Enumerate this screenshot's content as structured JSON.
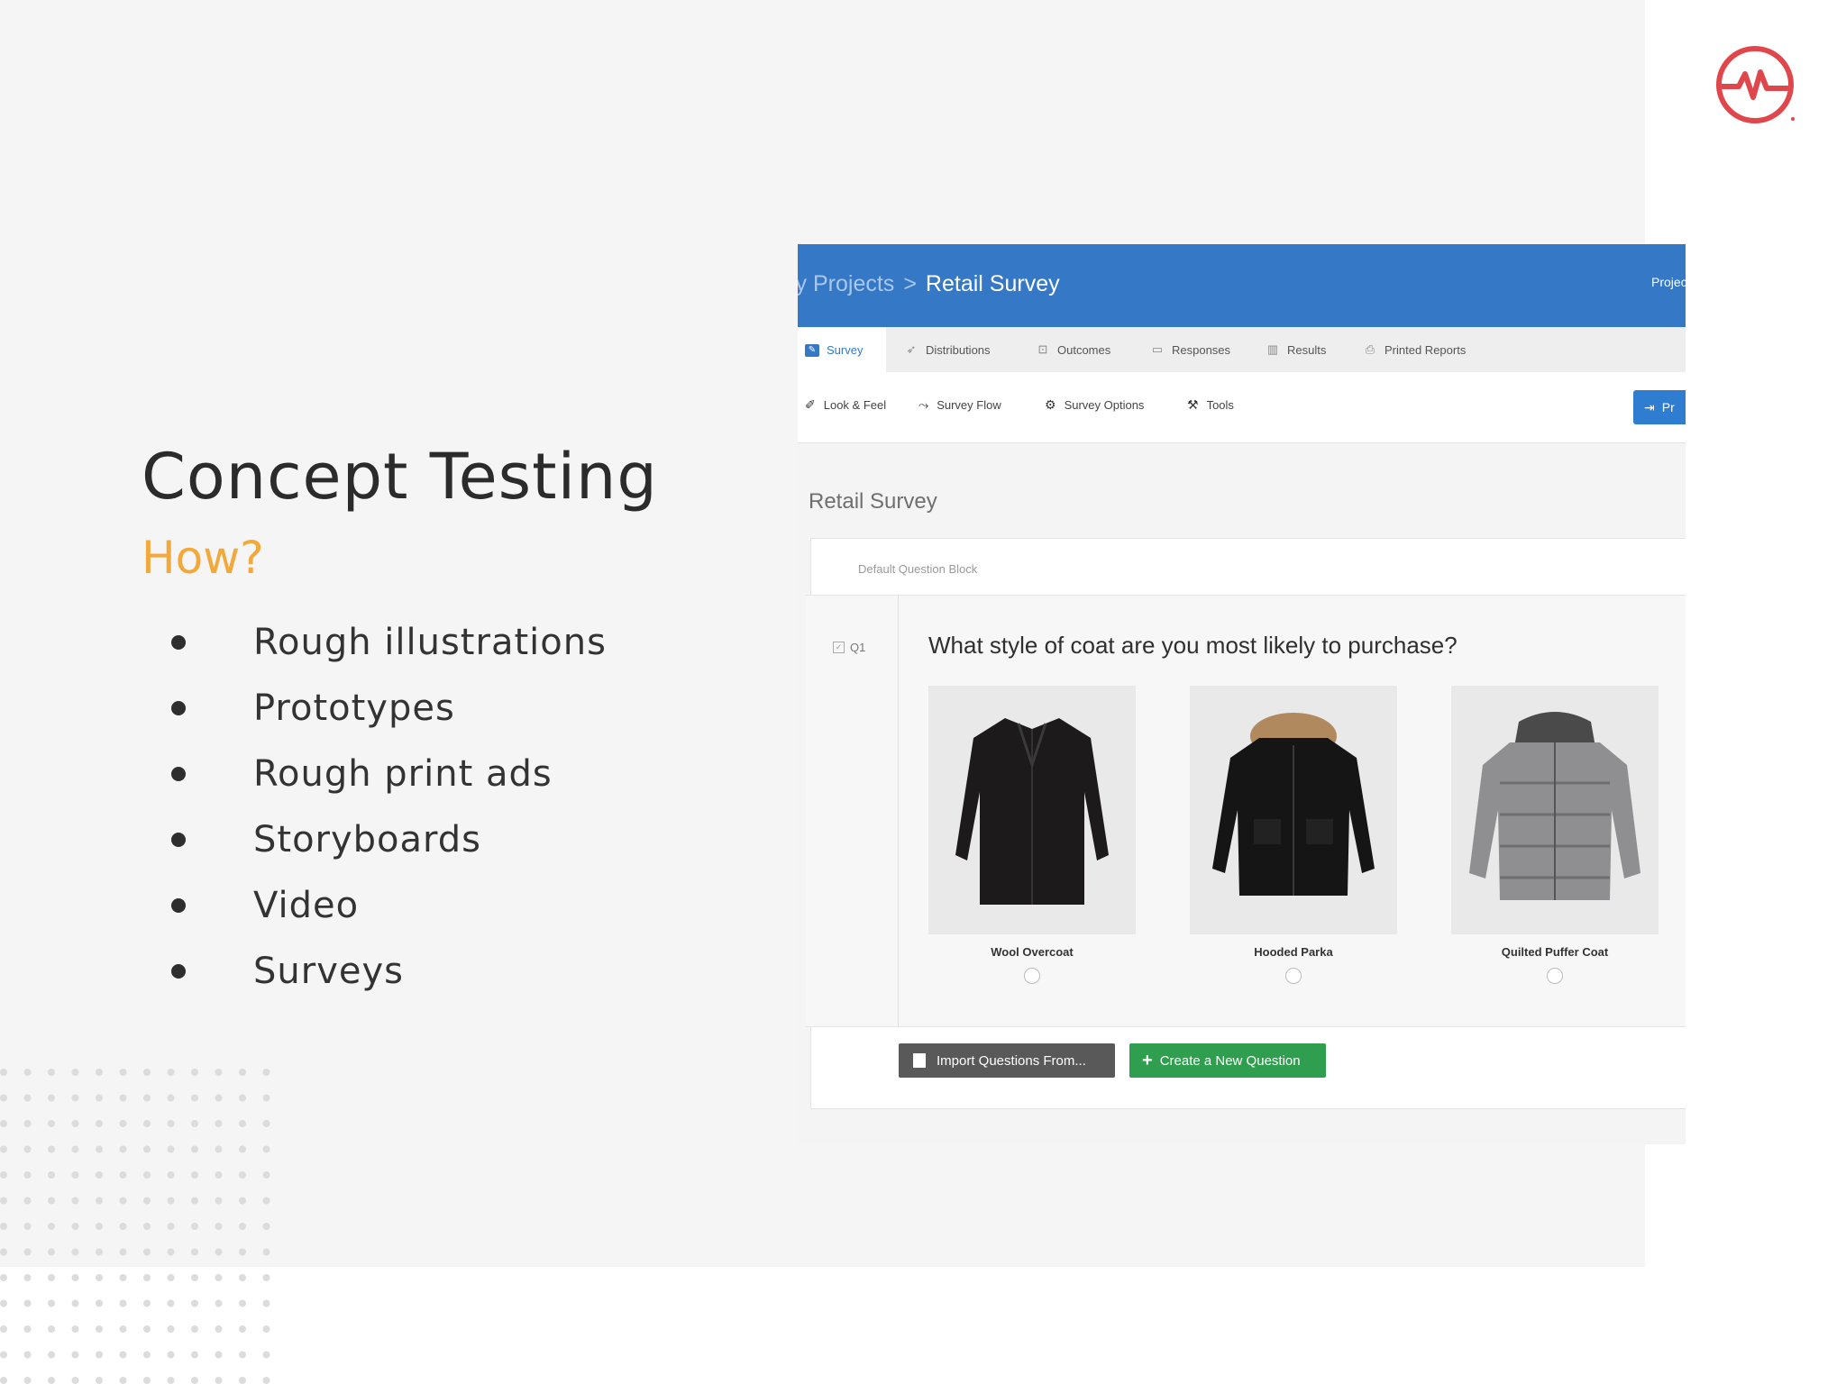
{
  "slide": {
    "title": "Concept Testing",
    "subtitle": "How?",
    "bullets": [
      "Rough illustrations",
      "Prototypes",
      "Rough print ads",
      "Storyboards",
      "Video",
      "Surveys"
    ],
    "logo_icon": "pulse-circle-icon",
    "accent_color": "#f2a93b",
    "logo_color": "#e0474c"
  },
  "app": {
    "breadcrumb": {
      "parent": "ly Projects",
      "separator": ">",
      "current": "Retail Survey"
    },
    "top_right": "Projec",
    "tabs": [
      "Survey",
      "Distributions",
      "Outcomes",
      "Responses",
      "Results",
      "Printed Reports"
    ],
    "tools": [
      "Look & Feel",
      "Survey Flow",
      "Survey Options",
      "Tools"
    ],
    "preview_label": "Pr",
    "survey_title": "Retail Survey",
    "block_label": "Default Question Block",
    "question": {
      "number": "Q1",
      "text": "What style of coat are you most likely to purchase?",
      "choices": [
        "Wool Overcoat",
        "Hooded Parka",
        "Quilted Puffer Coat"
      ]
    },
    "buttons": {
      "import": "Import Questions From...",
      "create": "Create a New Question"
    },
    "colors": {
      "topbar": "#3578c6",
      "create_button": "#2f9e4f",
      "import_button": "#595959"
    }
  }
}
